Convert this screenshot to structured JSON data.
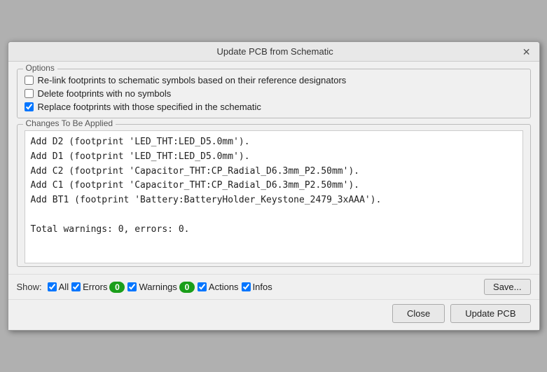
{
  "dialog": {
    "title": "Update PCB from Schematic",
    "close_label": "✕"
  },
  "options": {
    "group_label": "Options",
    "option1": {
      "label": "Re-link footprints to schematic symbols based on their reference designators",
      "checked": false
    },
    "option2": {
      "label": "Delete footprints with no symbols",
      "checked": false
    },
    "option3": {
      "label": "Replace footprints with those specified in the schematic",
      "checked": true
    }
  },
  "changes": {
    "group_label": "Changes To Be Applied",
    "lines": [
      "Add D2 (footprint 'LED_THT:LED_D5.0mm').",
      "Add D1 (footprint 'LED_THT:LED_D5.0mm').",
      "Add C2 (footprint 'Capacitor_THT:CP_Radial_D6.3mm_P2.50mm').",
      "Add C1 (footprint 'Capacitor_THT:CP_Radial_D6.3mm_P2.50mm').",
      "Add BT1 (footprint 'Battery:BatteryHolder_Keystone_2479_3xAAA')."
    ],
    "summary": "Total warnings: 0, errors: 0."
  },
  "filters": {
    "show_label": "Show:",
    "all_label": "All",
    "errors_label": "Errors",
    "errors_count": "0",
    "warnings_label": "Warnings",
    "warnings_count": "0",
    "actions_label": "Actions",
    "infos_label": "Infos",
    "save_label": "Save..."
  },
  "actions": {
    "close_label": "Close",
    "update_label": "Update PCB"
  }
}
